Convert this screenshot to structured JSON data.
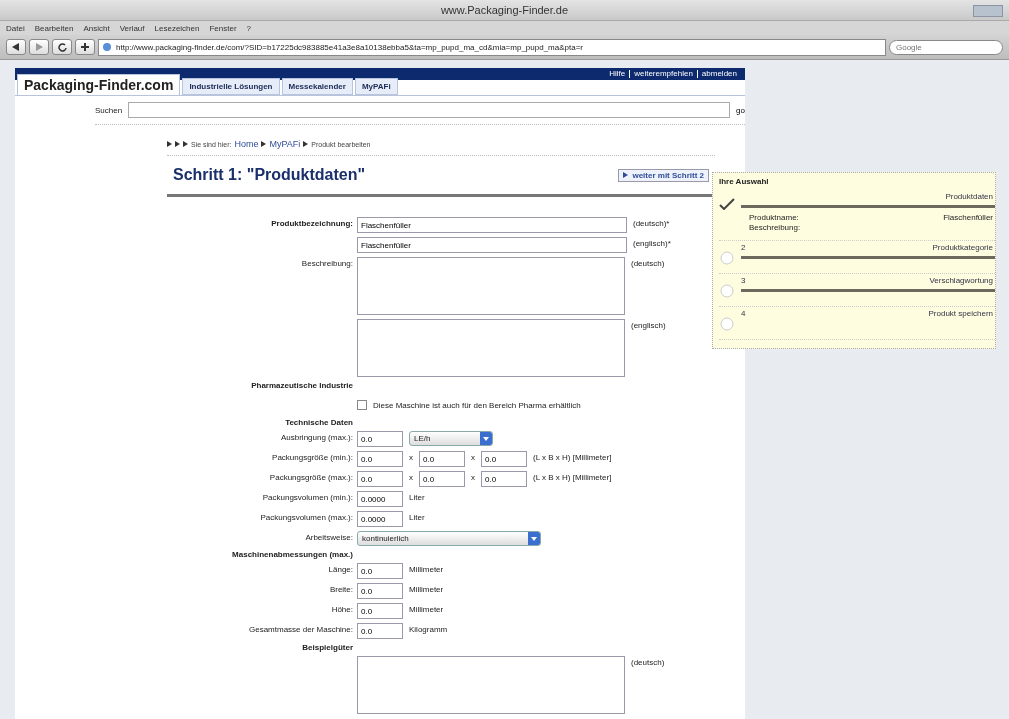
{
  "window": {
    "title": "www.Packaging-Finder.de",
    "menu": [
      "Datei",
      "Bearbeiten",
      "Ansicht",
      "Verlauf",
      "Lesezeichen",
      "Fenster",
      "?"
    ],
    "url": "http://www.packaging-finder.de/com/?SID=b17225dc983885e41a3e8a10138ebba5&ta=mp_pupd_ma_cd&mia=mp_pupd_ma&pta=r",
    "search_placeholder": "Google"
  },
  "header_links": [
    "Hilfe",
    "weiterempfehlen",
    "abmelden"
  ],
  "logo": "Packaging-Finder.com",
  "tabs": [
    {
      "label": "Industrielle Lösungen",
      "selected": false
    },
    {
      "label": "Messekalender",
      "selected": false
    },
    {
      "label": "MyPAFi",
      "selected": false
    }
  ],
  "search": {
    "label": "Suchen",
    "button": "go"
  },
  "breadcrumb": {
    "prefix": "Sie sind hier:",
    "items": [
      {
        "label": "Home",
        "link": true
      },
      {
        "label": "MyPAFi",
        "link": true
      },
      {
        "label": "Produkt bearbeiten",
        "link": false
      }
    ]
  },
  "step_title": "Schritt 1: \"Produktdaten\"",
  "next_button": "weiter mit Schritt 2",
  "form": [
    {
      "kind": "field",
      "label": "Produktbezeichnung:",
      "bold": true,
      "parts": [
        {
          "kind": "textfield",
          "value": "Flaschenfüller"
        },
        {
          "kind": "note",
          "text": "(deutsch)*"
        }
      ]
    },
    {
      "kind": "field",
      "parts": [
        {
          "kind": "textfield",
          "value": "Flaschenfüller"
        },
        {
          "kind": "note",
          "text": "(englisch)*"
        }
      ]
    },
    {
      "kind": "field",
      "label": "Beschreibung:",
      "bold": false,
      "parts": [
        {
          "kind": "textarea"
        },
        {
          "kind": "note",
          "text": "(deutsch)"
        }
      ]
    },
    {
      "kind": "field",
      "parts": [
        {
          "kind": "textarea"
        },
        {
          "kind": "note",
          "text": "(englisch)"
        }
      ]
    },
    {
      "kind": "heading",
      "label": "Pharmazeutische Industrie"
    },
    {
      "kind": "checkbox",
      "label": "Diese Maschine ist auch für den Bereich Pharma erhältlich",
      "checked": false
    },
    {
      "kind": "heading",
      "label": "Technische Daten"
    },
    {
      "kind": "field",
      "label": "Ausbringung (max.):",
      "bold": false,
      "parts": [
        {
          "kind": "numberfield",
          "value": "0.0"
        },
        {
          "kind": "unitselect",
          "value": "LE/h"
        }
      ]
    },
    {
      "kind": "field",
      "label": "Packungsgröße (min.):",
      "bold": false,
      "parts": [
        {
          "kind": "numberfield",
          "value": "0.0"
        },
        {
          "kind": "note",
          "text": "x"
        },
        {
          "kind": "numberfield",
          "value": "0.0"
        },
        {
          "kind": "note",
          "text": "x"
        },
        {
          "kind": "numberfield",
          "value": "0.0"
        },
        {
          "kind": "note",
          "text": "(L x B x H) [Millimeter]"
        }
      ]
    },
    {
      "kind": "field",
      "label": "Packungsgröße (max.):",
      "bold": false,
      "parts": [
        {
          "kind": "numberfield",
          "value": "0.0"
        },
        {
          "kind": "note",
          "text": "x"
        },
        {
          "kind": "numberfield",
          "value": "0.0"
        },
        {
          "kind": "note",
          "text": "x"
        },
        {
          "kind": "numberfield",
          "value": "0.0"
        },
        {
          "kind": "note",
          "text": "(L x B x H) [Millimeter]"
        }
      ]
    },
    {
      "kind": "field",
      "label": "Packungsvolumen (min.):",
      "bold": false,
      "parts": [
        {
          "kind": "numberfield",
          "value": "0.0000"
        },
        {
          "kind": "note",
          "text": "Liter"
        }
      ]
    },
    {
      "kind": "field",
      "label": "Packungsvolumen (max.):",
      "bold": false,
      "parts": [
        {
          "kind": "numberfield",
          "value": "0.0000"
        },
        {
          "kind": "note",
          "text": "Liter"
        }
      ]
    },
    {
      "kind": "field",
      "label": "Arbeitsweise:",
      "bold": false,
      "parts": [
        {
          "kind": "modeselect",
          "value": "kontinuierlich"
        }
      ]
    },
    {
      "kind": "heading",
      "label": "Maschinenabmessungen (max.)"
    },
    {
      "kind": "field",
      "label": "Länge:",
      "bold": false,
      "parts": [
        {
          "kind": "numberfield",
          "value": "0.0"
        },
        {
          "kind": "note",
          "text": "Millimeter"
        }
      ]
    },
    {
      "kind": "field",
      "label": "Breite:",
      "bold": false,
      "parts": [
        {
          "kind": "numberfield",
          "value": "0.0"
        },
        {
          "kind": "note",
          "text": "Millimeter"
        }
      ]
    },
    {
      "kind": "field",
      "label": "Höhe:",
      "bold": false,
      "parts": [
        {
          "kind": "numberfield",
          "value": "0.0"
        },
        {
          "kind": "note",
          "text": "Millimeter"
        }
      ]
    },
    {
      "kind": "field",
      "label": "Gesamtmasse der Maschine:",
      "bold": false,
      "parts": [
        {
          "kind": "numberfield",
          "value": "0.0"
        },
        {
          "kind": "note",
          "text": "Kilogramm"
        }
      ]
    },
    {
      "kind": "heading",
      "label": "Beispielgüter"
    },
    {
      "kind": "field",
      "parts": [
        {
          "kind": "textarea"
        },
        {
          "kind": "note",
          "text": "(deutsch)"
        }
      ]
    }
  ],
  "selection": {
    "title": "Ihre Auswahl",
    "steps": [
      {
        "done": true,
        "title": "Produktdaten",
        "rule": true,
        "details": [
          {
            "label": "Produktname:",
            "value": "Flaschenfüller"
          },
          {
            "label": "Beschreibung:"
          }
        ]
      },
      {
        "number": "2",
        "done": false,
        "title": "Produktkategorie",
        "rule": true
      },
      {
        "number": "3",
        "done": false,
        "title": "Verschlagwortung",
        "rule": true
      },
      {
        "number": "4",
        "done": false,
        "title": "Produkt speichern",
        "rule": false
      }
    ]
  }
}
